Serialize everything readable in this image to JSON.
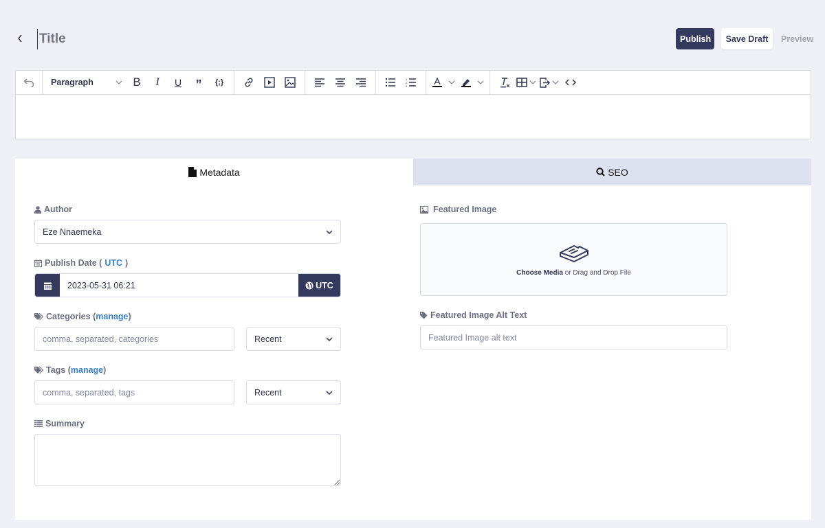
{
  "header": {
    "back_label": "Back",
    "title_placeholder": "Title",
    "publish_label": "Publish",
    "save_draft_label": "Save Draft",
    "preview_label": "Preview"
  },
  "editor": {
    "toolbar": {
      "undo": "undo-icon",
      "block_format": "Paragraph",
      "buttons": [
        "bold",
        "italic",
        "underline",
        "blockquote",
        "code",
        "link",
        "video",
        "image",
        "align-left",
        "align-center",
        "align-right",
        "bullet-list",
        "numbered-list",
        "text-color",
        "highlight-color",
        "clear-formatting",
        "table",
        "export",
        "source-code"
      ]
    },
    "content": ""
  },
  "tabs": [
    {
      "label": "Metadata",
      "icon": "file-icon",
      "active": true
    },
    {
      "label": "SEO",
      "icon": "search-icon",
      "active": false
    }
  ],
  "metadata": {
    "author": {
      "label": "Author",
      "value": "Eze Nnaemeka"
    },
    "publish_date": {
      "label_prefix": "Publish Date (",
      "label_link": "UTC",
      "label_suffix": ")",
      "value": "2023-05-31 06:21",
      "tz_button": "UTC"
    },
    "categories": {
      "label": "Categories (",
      "link": "manage",
      "label_suffix": ")",
      "placeholder": "comma, separated, categories",
      "filter": "Recent"
    },
    "tags": {
      "label": "Tags (",
      "link": "manage",
      "label_suffix": ")",
      "placeholder": "comma, separated, tags",
      "filter": "Recent"
    },
    "summary": {
      "label": "Summary",
      "value": ""
    },
    "featured_image": {
      "label": "Featured Image",
      "choose": "Choose Media",
      "drop_text": " or Drag and Drop File"
    },
    "alt_text": {
      "label": "Featured Image Alt Text",
      "placeholder": "Featured Image alt text"
    }
  },
  "colors": {
    "primary": "#34395e",
    "link": "#3a7fc1",
    "background": "#eff0f6",
    "tab_inactive": "#dde0ee"
  }
}
